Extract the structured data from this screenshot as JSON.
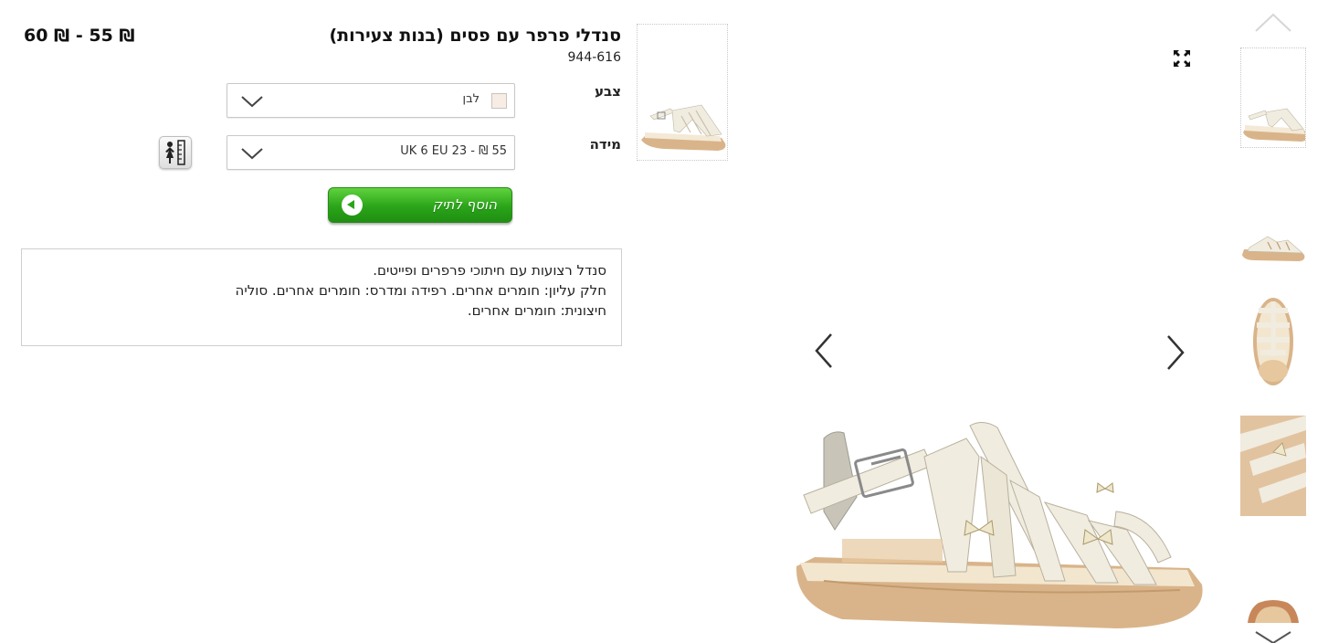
{
  "product": {
    "title": "סנדלי פרפר עם פסים (בנות צעירות)",
    "sku": "944-616",
    "price_range": "60 ₪ - 55 ₪"
  },
  "options": {
    "color_label": "צבע",
    "color_value": "לבן",
    "size_label": "מידה",
    "size_value": "UK 6 EU 23 - ₪ 55"
  },
  "actions": {
    "add_to_bag": "הוסף לתיק"
  },
  "description": {
    "line1": "סנדל רצועות עם חיתוכי פרפרים ופייטים.",
    "line2": "חלק עליון: חומרים אחרים. רפידה ומדרס: חומרים אחרים. סוליה",
    "line3": "חיצונית: חומרים אחרים."
  },
  "colors": {
    "add_button": "#2ba41a",
    "swatch_white": "#f7ede5",
    "sandal_cream": "#f1ece0",
    "sole_tan": "#d9b48a"
  },
  "icons": {
    "expand": "expand-arrows-icon",
    "prev": "chevron-left-icon",
    "next": "chevron-right-icon",
    "strip_up": "chevron-up-icon",
    "strip_down": "chevron-down-icon",
    "size_guide": "size-guide-icon",
    "dropdown": "chevron-down-icon"
  }
}
